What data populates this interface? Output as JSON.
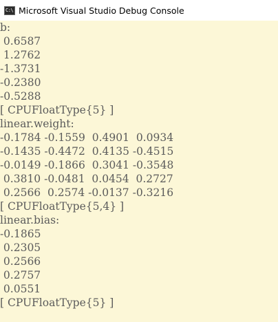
{
  "window": {
    "title": "Microsoft Visual Studio Debug Console",
    "icon": "console-app-icon",
    "icon_text": "C:\\"
  },
  "console": {
    "lines": [
      "b:",
      " 0.6587",
      " 1.2762",
      "-1.3731",
      "-0.2380",
      "-0.5288",
      "[ CPUFloatType{5} ]",
      "linear.weight:",
      "-0.1784 -0.1559  0.4901  0.0934",
      "-0.1435 -0.4472  0.4135 -0.4515",
      "-0.0149 -0.1866  0.3041 -0.3548",
      " 0.3810 -0.0481  0.0454  0.2727",
      " 0.2566  0.2574 -0.0137 -0.3216",
      "[ CPUFloatType{5,4} ]",
      "linear.bias:",
      "-0.1865",
      " 0.2305",
      " 0.2566",
      " 0.2757",
      " 0.0551",
      "[ CPUFloatType{5} ]"
    ]
  },
  "colors": {
    "console_background": "#fcf7d7",
    "console_text": "#5b5b5b",
    "titlebar_background": "#ffffff"
  }
}
